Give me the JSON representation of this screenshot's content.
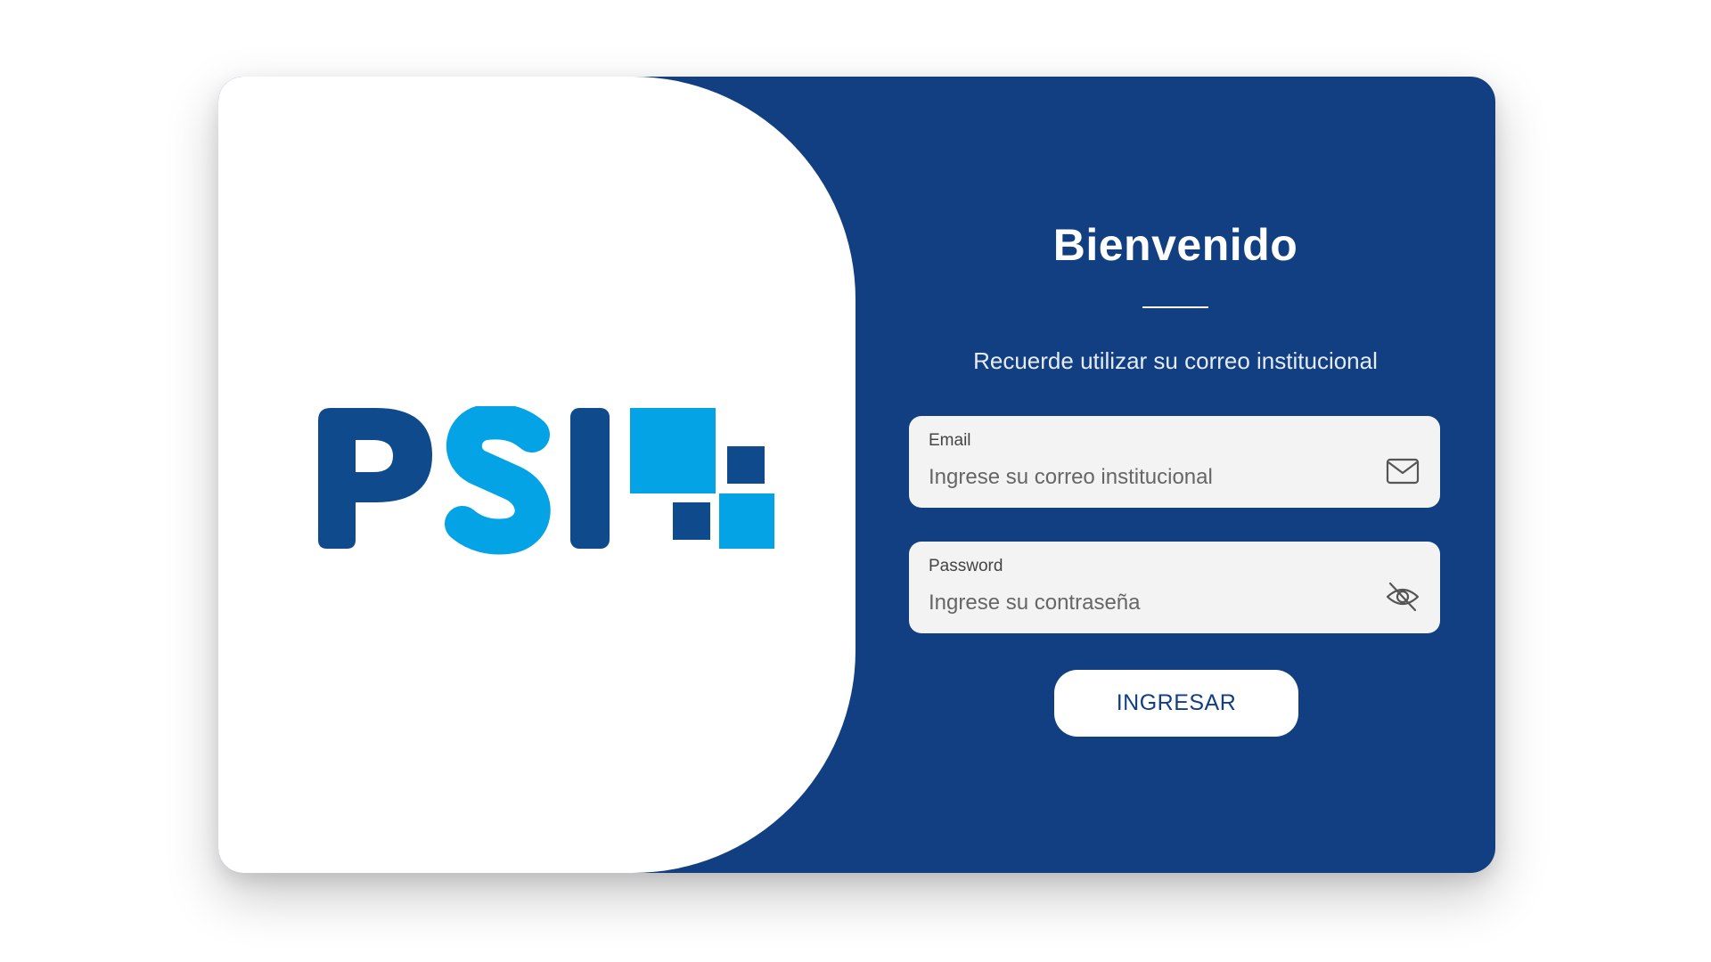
{
  "brand": {
    "logo_text": "PSI",
    "colors": {
      "dark_blue": "#0f4a8c",
      "light_blue": "#03a3e5",
      "panel_blue": "#123f82"
    }
  },
  "login": {
    "title": "Bienvenido",
    "subtitle": "Recuerde utilizar su correo institucional",
    "email": {
      "label": "Email",
      "placeholder": "Ingrese su correo institucional",
      "value": "",
      "icon": "envelope-icon"
    },
    "password": {
      "label": "Password",
      "placeholder": "Ingrese su contraseña",
      "value": "",
      "icon": "eye-off-icon"
    },
    "submit_label": "INGRESAR"
  }
}
